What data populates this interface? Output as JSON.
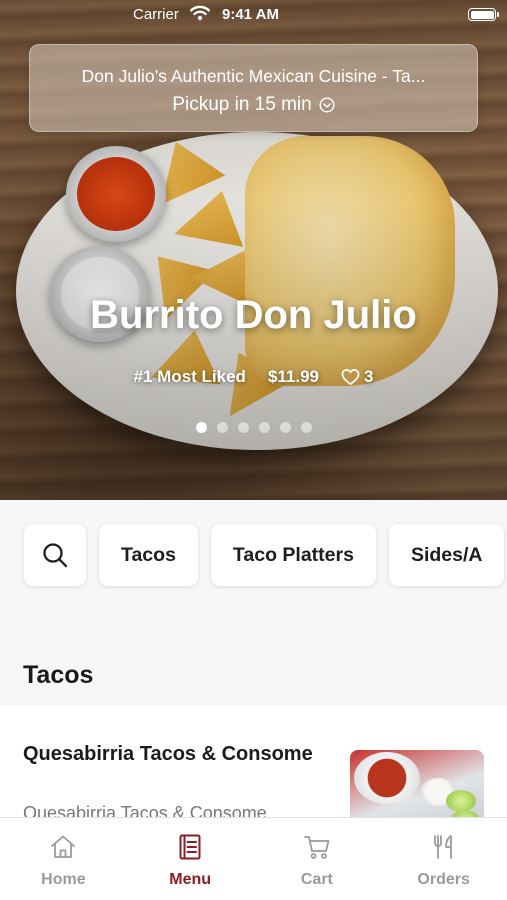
{
  "status_bar": {
    "carrier": "Carrier",
    "time": "9:41 AM"
  },
  "pickup_banner": {
    "restaurant_name": "Don Julio’s Authentic Mexican Cuisine - Ta...",
    "pickup_text": "Pickup in 15 min"
  },
  "featured": {
    "dish_name": "Burrito Don Julio",
    "badge": "#1 Most Liked",
    "price": "$11.99",
    "likes": "3",
    "slide_count": 6,
    "active_slide": 1
  },
  "categories": {
    "search_icon": "search-icon",
    "items": [
      "Tacos",
      "Taco Platters",
      "Sides/A"
    ]
  },
  "section": {
    "title": "Tacos"
  },
  "menu_item": {
    "name": "Quesabirria Tacos & Consome",
    "description": "Quesabirria Tacos & Consome"
  },
  "tab_bar": {
    "active_color": "#8c1c22",
    "inactive_color": "#9a9a9a",
    "tabs": [
      {
        "label": "Home",
        "icon": "home-icon",
        "active": false
      },
      {
        "label": "Menu",
        "icon": "menu-book-icon",
        "active": true
      },
      {
        "label": "Cart",
        "icon": "cart-icon",
        "active": false
      },
      {
        "label": "Orders",
        "icon": "utensils-icon",
        "active": false
      }
    ]
  }
}
